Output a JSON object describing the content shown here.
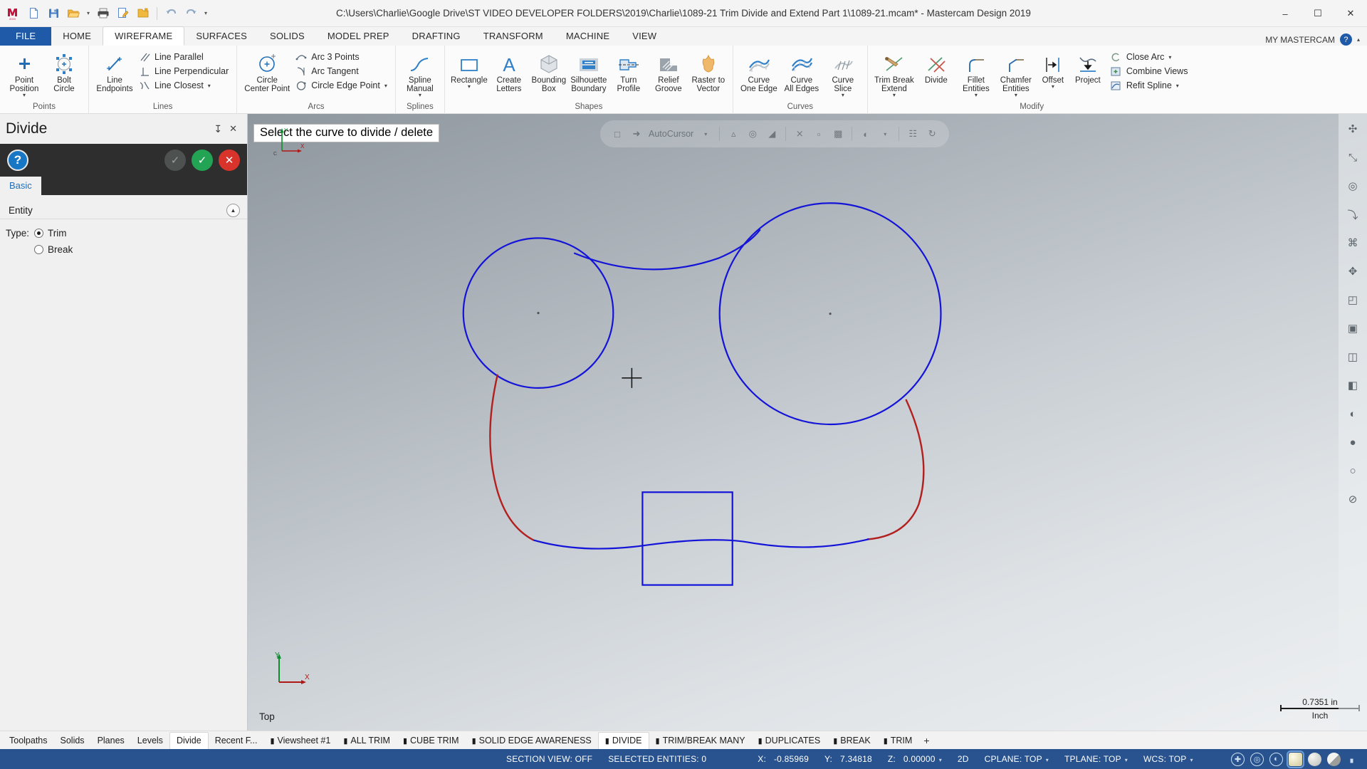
{
  "window": {
    "title": "C:\\Users\\Charlie\\Google Drive\\ST VIDEO DEVELOPER FOLDERS\\2019\\Charlie\\1089-21 Trim Divide and Extend Part 1\\1089-21.mcam* - Mastercam Design 2019",
    "minimize": "–",
    "maximize": "☐",
    "close": "✕"
  },
  "quick_access": {
    "items": [
      {
        "name": "mastercam-logo-icon",
        "label": ""
      },
      {
        "name": "new-file-icon",
        "label": ""
      },
      {
        "name": "save-icon",
        "label": ""
      },
      {
        "name": "open-folder-icon",
        "label": ""
      },
      {
        "name": "print-icon",
        "label": ""
      },
      {
        "name": "print-preview-icon",
        "label": ""
      },
      {
        "name": "folder-icon",
        "label": ""
      },
      {
        "name": "undo-icon",
        "label": ""
      },
      {
        "name": "redo-icon",
        "label": ""
      }
    ],
    "overflow_caret": "▾"
  },
  "ribbon": {
    "tabs": [
      {
        "label": "FILE",
        "active": false,
        "file": true
      },
      {
        "label": "HOME",
        "active": false
      },
      {
        "label": "WIREFRAME",
        "active": true
      },
      {
        "label": "SURFACES",
        "active": false
      },
      {
        "label": "SOLIDS",
        "active": false
      },
      {
        "label": "MODEL PREP",
        "active": false
      },
      {
        "label": "DRAFTING",
        "active": false
      },
      {
        "label": "TRANSFORM",
        "active": false
      },
      {
        "label": "MACHINE",
        "active": false
      },
      {
        "label": "VIEW",
        "active": false
      }
    ],
    "account_label": "MY MASTERCAM",
    "help_label": "?",
    "groups": [
      {
        "label": "Points",
        "big": [
          {
            "name": "point-position-button",
            "label": "Point\nPosition",
            "icon": "plus-point",
            "caret": true
          },
          {
            "name": "bolt-circle-button",
            "label": "Bolt\nCircle",
            "icon": "bolt-circle",
            "caret": false
          }
        ],
        "small": []
      },
      {
        "label": "Lines",
        "big": [
          {
            "name": "line-endpoints-button",
            "label": "Line\nEndpoints",
            "icon": "line-endpoints",
            "caret": false
          }
        ],
        "small": [
          {
            "name": "line-parallel-button",
            "label": "Line Parallel",
            "icon": "parallel",
            "caret": false
          },
          {
            "name": "line-perpendicular-button",
            "label": "Line Perpendicular",
            "icon": "perpendicular",
            "caret": false
          },
          {
            "name": "line-closest-button",
            "label": "Line Closest",
            "icon": "closest",
            "caret": true
          }
        ]
      },
      {
        "label": "Arcs",
        "big": [
          {
            "name": "circle-center-point-button",
            "label": "Circle\nCenter Point",
            "icon": "circle-center",
            "caret": false
          }
        ],
        "small": [
          {
            "name": "arc-3-points-button",
            "label": "Arc 3 Points",
            "icon": "arc3",
            "caret": false
          },
          {
            "name": "arc-tangent-button",
            "label": "Arc Tangent",
            "icon": "arctan",
            "caret": false
          },
          {
            "name": "circle-edge-point-button",
            "label": "Circle Edge Point",
            "icon": "circleedge",
            "caret": true
          }
        ]
      },
      {
        "label": "Splines",
        "big": [
          {
            "name": "spline-manual-button",
            "label": "Spline\nManual",
            "icon": "spline",
            "caret": true
          }
        ],
        "small": []
      },
      {
        "label": "Shapes",
        "big": [
          {
            "name": "rectangle-button",
            "label": "Rectangle",
            "icon": "rectangle",
            "caret": true
          },
          {
            "name": "create-letters-button",
            "label": "Create\nLetters",
            "icon": "letters",
            "caret": false
          },
          {
            "name": "bounding-box-button",
            "label": "Bounding\nBox",
            "icon": "bbox",
            "caret": false
          },
          {
            "name": "silhouette-boundary-button",
            "label": "Silhouette\nBoundary",
            "icon": "silhouette",
            "caret": false
          },
          {
            "name": "turn-profile-button",
            "label": "Turn\nProfile",
            "icon": "turn",
            "caret": false
          },
          {
            "name": "relief-groove-button",
            "label": "Relief\nGroove",
            "icon": "relief",
            "caret": false
          },
          {
            "name": "raster-to-vector-button",
            "label": "Raster to\nVector",
            "icon": "raster",
            "caret": false
          }
        ],
        "small": []
      },
      {
        "label": "Curves",
        "big": [
          {
            "name": "curve-one-edge-button",
            "label": "Curve\nOne Edge",
            "icon": "curve1",
            "caret": false
          },
          {
            "name": "curve-all-edges-button",
            "label": "Curve\nAll Edges",
            "icon": "curveall",
            "caret": false
          },
          {
            "name": "curve-slice-button",
            "label": "Curve\nSlice",
            "icon": "curveslice",
            "caret": true
          }
        ],
        "small": []
      },
      {
        "label": "Modify",
        "big": [
          {
            "name": "trim-break-extend-button",
            "label": "Trim Break\nExtend",
            "icon": "trimbreak",
            "caret": true
          },
          {
            "name": "divide-button",
            "label": "Divide",
            "icon": "divide",
            "caret": false
          },
          {
            "name": "fillet-entities-button",
            "label": "Fillet\nEntities",
            "icon": "fillet",
            "caret": true
          },
          {
            "name": "chamfer-entities-button",
            "label": "Chamfer\nEntities",
            "icon": "chamfer",
            "caret": true
          },
          {
            "name": "offset-button",
            "label": "Offset",
            "icon": "offset",
            "caret": true
          },
          {
            "name": "project-button",
            "label": "Project",
            "icon": "project",
            "caret": false
          }
        ],
        "small": [
          {
            "name": "close-arc-button",
            "label": "Close Arc",
            "icon": "closearc",
            "caret": true
          },
          {
            "name": "combine-views-button",
            "label": "Combine Views",
            "icon": "combineviews",
            "caret": false
          },
          {
            "name": "refit-spline-button",
            "label": "Refit Spline",
            "icon": "refitspline",
            "caret": true
          }
        ]
      }
    ]
  },
  "panel": {
    "title": "Divide",
    "pin_icon": "↧",
    "close_icon": "✕",
    "help_label": "?",
    "toolbar_buttons": [
      {
        "name": "reapply-button",
        "label": "✓",
        "style": "gray"
      },
      {
        "name": "ok-button",
        "label": "✓",
        "style": "green"
      },
      {
        "name": "cancel-button",
        "label": "✕",
        "style": "red"
      }
    ],
    "tabs": [
      {
        "label": "Basic",
        "active": true
      }
    ],
    "section": {
      "title": "Entity",
      "collapse_icon": "▲",
      "type_label": "Type:",
      "options": [
        {
          "label": "Trim",
          "selected": true
        },
        {
          "label": "Break",
          "selected": false
        }
      ]
    }
  },
  "viewport": {
    "prompt": "Select the curve to divide / delete",
    "view_name": "Top",
    "scale_value": "0.7351 in",
    "scale_unit": "Inch",
    "axis_x": "X",
    "axis_y": "Y",
    "autocursor": {
      "label": "AutoCursor",
      "caret": "▾",
      "icons": [
        "endpoint-icon",
        "cursor-arrow-icon",
        "midpoint-icon",
        "center-icon",
        "quadrant-icon",
        "intersection-icon",
        "point-icon",
        "nearest-icon",
        "tangent-icon",
        "perpendicular-icon",
        "origin-icon"
      ]
    },
    "geometry_colors": {
      "wireframe": "#0b1fd8",
      "selected": "#c0392b",
      "background_top": "#8e969e",
      "background_bottom": "#eef0f2"
    }
  },
  "right_rail": {
    "items": [
      {
        "name": "fit-icon",
        "glyph": "✣"
      },
      {
        "name": "zoom-window-icon",
        "glyph": "⤡"
      },
      {
        "name": "zoom-target-icon",
        "glyph": "◎"
      },
      {
        "name": "unzoom-icon",
        "glyph": "⤵"
      },
      {
        "name": "dynamic-rotate-icon",
        "glyph": "⌘"
      },
      {
        "name": "pan-icon",
        "glyph": "✥"
      },
      {
        "name": "isometric-view-icon",
        "glyph": "◰"
      },
      {
        "name": "top-view-icon",
        "glyph": "▣"
      },
      {
        "name": "front-view-icon",
        "glyph": "◫"
      },
      {
        "name": "right-view-icon",
        "glyph": "◧"
      },
      {
        "name": "wireframe-shading-icon",
        "glyph": "◐"
      },
      {
        "name": "shaded-icon",
        "glyph": "●"
      },
      {
        "name": "hidden-lines-icon",
        "glyph": "○"
      },
      {
        "name": "blank-icon",
        "glyph": "⊘"
      }
    ]
  },
  "bottom_tabs": {
    "left": [
      {
        "label": "Toolpaths",
        "active": false
      },
      {
        "label": "Solids",
        "active": false
      },
      {
        "label": "Planes",
        "active": false
      },
      {
        "label": "Levels",
        "active": false
      },
      {
        "label": "Divide",
        "active": true
      },
      {
        "label": "Recent F...",
        "active": false
      }
    ],
    "sheets": [
      {
        "label": "Viewsheet #1",
        "active": false
      },
      {
        "label": "ALL TRIM",
        "active": false
      },
      {
        "label": "CUBE TRIM",
        "active": false
      },
      {
        "label": "SOLID EDGE AWARENESS",
        "active": false
      },
      {
        "label": "DIVIDE",
        "active": true
      },
      {
        "label": "TRIM/BREAK MANY",
        "active": false
      },
      {
        "label": "DUPLICATES",
        "active": false
      },
      {
        "label": "BREAK",
        "active": false
      },
      {
        "label": "TRIM",
        "active": false
      }
    ],
    "add_label": "+"
  },
  "statusbar": {
    "section_view": "SECTION VIEW: OFF",
    "selected_entities": "SELECTED ENTITIES: 0",
    "x_label": "X:",
    "x_value": "-0.85969",
    "y_label": "Y:",
    "y_value": "7.34818",
    "z_label": "Z:",
    "z_value": "0.00000",
    "dimension_mode": "2D",
    "cplane": "CPLANE: TOP",
    "tplane": "TPLANE: TOP",
    "wcs": "WCS: TOP",
    "background": "#28538f"
  }
}
